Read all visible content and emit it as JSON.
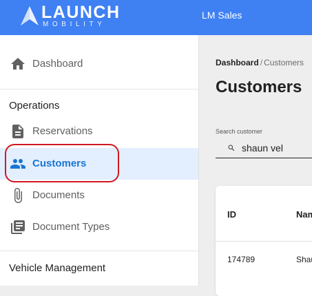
{
  "topbar": {
    "logo_word": "LAUNCH",
    "logo_sub": "MOBILITY",
    "org_name": "LM Sales",
    "color": "#3f80f3"
  },
  "sidebar": {
    "items": [
      {
        "label": "Dashboard",
        "icon": "home-icon"
      },
      {
        "label": "Reservations",
        "icon": "document-icon"
      },
      {
        "label": "Customers",
        "icon": "people-icon",
        "active": true
      },
      {
        "label": "Documents",
        "icon": "paperclip-icon"
      },
      {
        "label": "Document Types",
        "icon": "library-icon"
      }
    ],
    "sections": {
      "operations": "Operations",
      "vehicle_management": "Vehicle Management"
    }
  },
  "main": {
    "breadcrumb": {
      "root": "Dashboard",
      "separator": "/",
      "current": "Customers"
    },
    "title": "Customers",
    "search": {
      "label": "Search customer",
      "value": "shaun vel"
    },
    "table": {
      "headers": [
        "ID",
        "Nam"
      ],
      "rows": [
        [
          "174789",
          "Shau"
        ]
      ]
    }
  },
  "colors": {
    "accent": "#1976d2",
    "active_bg": "#e3efff",
    "highlight": "#d01820"
  }
}
